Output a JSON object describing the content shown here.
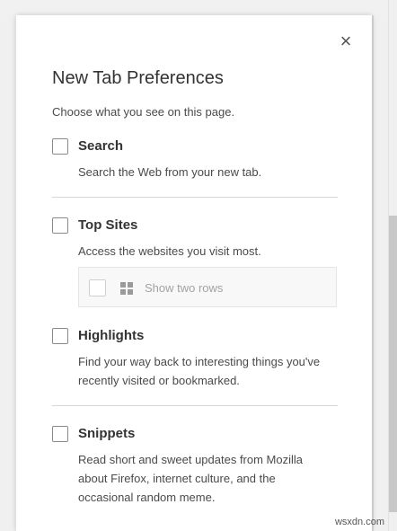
{
  "panel": {
    "title": "New Tab Preferences",
    "subtitle": "Choose what you see on this page.",
    "close_icon": "×"
  },
  "sections": [
    {
      "title": "Search",
      "description": "Search the Web from your new tab.",
      "checked": false
    },
    {
      "title": "Top Sites",
      "description": "Access the websites you visit most.",
      "checked": false,
      "subpref": {
        "label": "Show two rows",
        "checked": false,
        "icon": "grid-icon"
      }
    },
    {
      "title": "Highlights",
      "description": "Find your way back to interesting things you've recently visited or bookmarked.",
      "checked": false
    },
    {
      "title": "Snippets",
      "description": "Read short and sweet updates from Mozilla about Firefox, internet culture, and the occasional random meme.",
      "checked": false
    }
  ],
  "watermark": "wsxdn.com"
}
